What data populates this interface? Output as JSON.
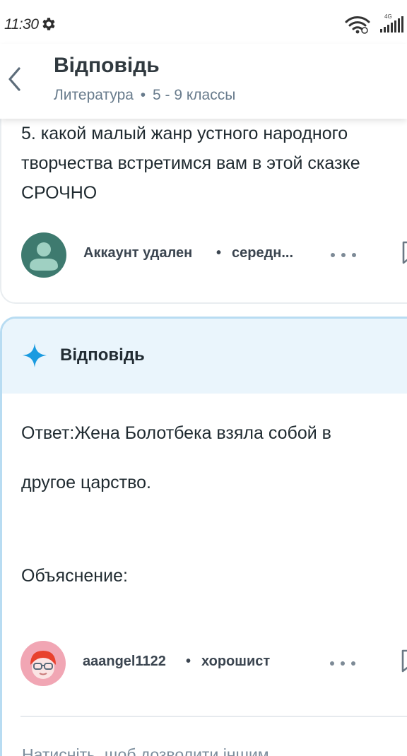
{
  "status_bar": {
    "time": "11:30",
    "network_label": "4G",
    "icons": [
      "gear-icon",
      "wifi-icon",
      "signal-icon"
    ]
  },
  "header": {
    "title": "Відповідь",
    "subject": "Литература",
    "separator": "•",
    "grade": "5 - 9 классы"
  },
  "question": {
    "text": "5. какой малый жанр устного народного творчества встретимся вам в этой сказке СРОЧНО",
    "author": {
      "name": "Аккаунт удален",
      "separator": "•",
      "rank": "середн..."
    }
  },
  "answer": {
    "heading": "Відповідь",
    "lines": [
      "Ответ:Жена Болотбека взяла собой в",
      "другое царство.",
      "Объяснение:"
    ],
    "author": {
      "name": "aaangel1122",
      "separator": "•",
      "rank": "хорошист"
    },
    "bottom_hint": "Натисніть, щоб дозволити іншим"
  },
  "colors": {
    "accent_blue": "#1a9be0",
    "answer_border": "#b8dcf2",
    "answer_header_bg": "#eaf5fc",
    "avatar_question": "#3e7a6f",
    "avatar_answer": "#f1a6b4"
  }
}
